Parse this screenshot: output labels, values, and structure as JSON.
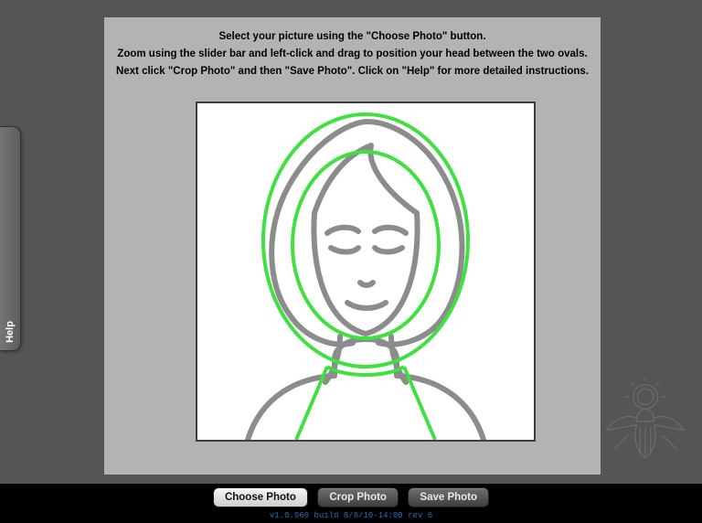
{
  "instructions": {
    "line1": "Select your picture using the \"Choose Photo\" button.",
    "line2": "Zoom using the slider bar and left-click and drag to position your head between the two ovals.",
    "line3": "Next click \"Crop Photo\" and then \"Save Photo\".  Click on \"Help\" for more detailed instructions."
  },
  "help_tab": {
    "label": "Help"
  },
  "buttons": {
    "choose": "Choose Photo",
    "crop": "Crop Photo",
    "save": "Save Photo"
  },
  "footer": {
    "version": "v1.0.960 build 8/8/10-14:00 rev 6"
  },
  "icons": {
    "portrait": "portrait-placeholder-icon",
    "guide_ovals": "head-guide-ovals",
    "seal": "eagle-seal-icon"
  },
  "colors": {
    "guide": "#41e041",
    "panel_bg": "#b3b3b3",
    "stage_bg": "#555555"
  }
}
